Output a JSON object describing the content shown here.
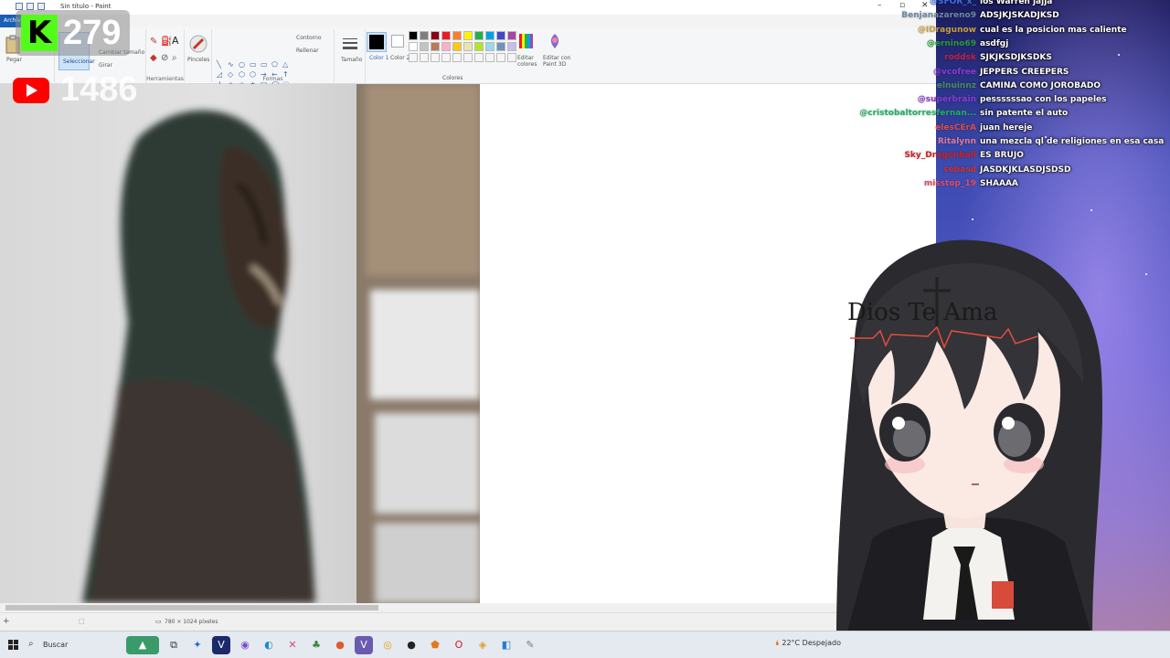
{
  "window": {
    "title": "Sin título - Paint",
    "file_tab": "Archivo"
  },
  "ribbon": {
    "clipboard": {
      "paste": "Pegar"
    },
    "image": {
      "select": "Seleccionar",
      "resize": "Cambiar tamaño",
      "rotate": "Girar"
    },
    "tools_label": "Herramientas",
    "brushes": "Pinceles",
    "shapes_label": "Formas",
    "outline": "Contorno",
    "fill": "Rellenar",
    "size": "Tamaño",
    "color1": "Color 1",
    "color2": "Color 2",
    "colors_label": "Colores",
    "edit_colors": "Editar colores",
    "edit_paint3d": "Editar con Paint 3D",
    "palette": [
      "#000000",
      "#7f7f7f",
      "#880015",
      "#ed1c24",
      "#ff7f27",
      "#fff200",
      "#22b14c",
      "#00a2e8",
      "#3f48cc",
      "#a349a4",
      "#ffffff",
      "#c3c3c3",
      "#b97a57",
      "#ffaec9",
      "#ffc90e",
      "#efe4b0",
      "#b5e61d",
      "#99d9ea",
      "#7092be",
      "#c8bfe7",
      "#f5f5f5",
      "#f5f5f5",
      "#f5f5f5",
      "#f5f5f5",
      "#f5f5f5",
      "#f5f5f5",
      "#f5f5f5",
      "#f5f5f5",
      "#f5f5f5",
      "#f5f5f5"
    ]
  },
  "status": {
    "dimensions": "780 × 1024 píxeles"
  },
  "taskbar": {
    "search_placeholder": "Buscar",
    "weather": "22°C  Despejado"
  },
  "overlays": {
    "kick_count": "279",
    "youtube_count": "1486"
  },
  "chat": [
    {
      "user": "@SFOR_x_",
      "message": "los Warren jajja",
      "color": "#3a6fe0"
    },
    {
      "user": "Benjanazareno9",
      "message": "ADSJKJSKADJKSD",
      "color": "#6b8aa0"
    },
    {
      "user": "@IDragunow",
      "message": "cual es la posicion mas caliente",
      "color": "#c8a040"
    },
    {
      "user": "@ernino69",
      "message": "asdfgj",
      "color": "#2a9a3a"
    },
    {
      "user": "roddsk",
      "message": "SJKJKSDJKSDKS",
      "color": "#c0204a"
    },
    {
      "user": "@vcofree",
      "message": "JEPPERS CREEPERS",
      "color": "#8a3ad0"
    },
    {
      "user": "elnuinnz",
      "message": "CAMINA COMO JOROBADO",
      "color": "#4a8a5a"
    },
    {
      "user": "@superbrain",
      "message": "pessssssao con los papeles",
      "color": "#8a3ad0"
    },
    {
      "user": "@cristobaltorresfernan...",
      "message": "sin patente el auto",
      "color": "#20b060"
    },
    {
      "user": "elesCErA",
      "message": "juan hereje",
      "color": "#e04a4a"
    },
    {
      "user": "Ritalynn",
      "message": "una mezcla ql de religiones en esa casa",
      "color": "#e07a9a"
    },
    {
      "user": "Sky_Dragonball",
      "message": "ES BRUJO",
      "color": "#d02020"
    },
    {
      "user": "sebasd",
      "message": "JASDKJKLASDJSDSD",
      "color": "#d03030"
    },
    {
      "user": "misstop_19",
      "message": "SHAAAA",
      "color": "#e04a6a"
    }
  ],
  "avatar": {
    "headband_text": "Dios Te Ama"
  }
}
